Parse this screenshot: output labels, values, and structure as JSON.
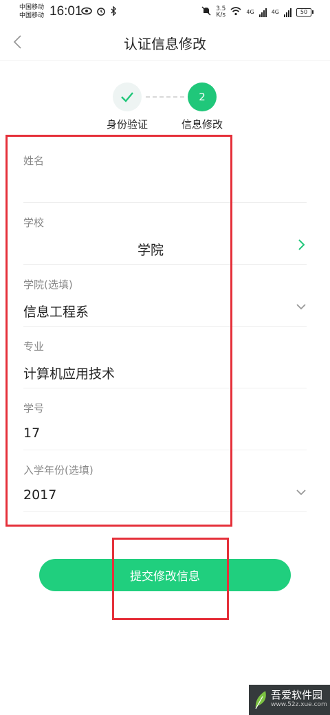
{
  "status_bar": {
    "carrier1": "中国移动",
    "carrier2": "中国移动",
    "time": "16:01",
    "speed_value": "3.5",
    "speed_unit": "K/s",
    "net1": "4G",
    "net2": "4G",
    "battery": "50"
  },
  "header": {
    "title": "认证信息修改"
  },
  "steps": [
    {
      "label": "身份验证",
      "state": "done"
    },
    {
      "label": "信息修改",
      "number": "2",
      "state": "active"
    }
  ],
  "form": {
    "name": {
      "label": "姓名",
      "value": ""
    },
    "school": {
      "label": "学校",
      "value": "学院"
    },
    "college": {
      "label": "学院(选填)",
      "value": "信息工程系"
    },
    "major": {
      "label": "专业",
      "value": "计算机应用技术"
    },
    "student_id": {
      "label": "学号",
      "value": "17"
    },
    "year": {
      "label": "入学年份(选填)",
      "value": "2017"
    }
  },
  "submit": {
    "label": "提交修改信息"
  },
  "watermark": {
    "title": "吾爱软件园",
    "url": "www.52z.xue.com"
  },
  "colors": {
    "accent": "#20cf7e",
    "annotation": "#e5303a"
  }
}
